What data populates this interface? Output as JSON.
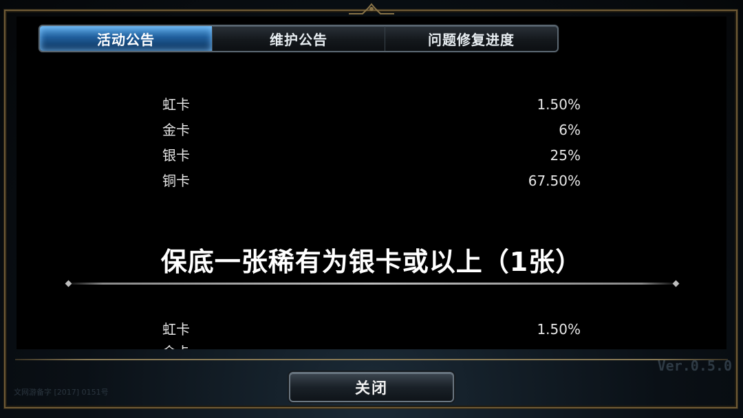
{
  "tabs": [
    {
      "label": "活动公告",
      "active": true
    },
    {
      "label": "维护公告",
      "active": false
    },
    {
      "label": "问题修复进度",
      "active": false
    }
  ],
  "rates_top": [
    {
      "name": "虹卡",
      "rate": "1.50%"
    },
    {
      "name": "金卡",
      "rate": "6%"
    },
    {
      "name": "银卡",
      "rate": "25%"
    },
    {
      "name": "铜卡",
      "rate": "67.50%"
    }
  ],
  "headline": "保底一张稀有为银卡或以上（1张）",
  "rates_bottom": [
    {
      "name": "虹卡",
      "rate": "1.50%"
    }
  ],
  "cut_row_label": "金卡",
  "close_label": "关闭",
  "version": "Ver.0.5.0",
  "license": "文网游备字 [2017] 0151号",
  "colors": {
    "active_tab": "#1f5e9c",
    "frame_gold": "#6e5a35",
    "text": "#e6e6e6"
  }
}
